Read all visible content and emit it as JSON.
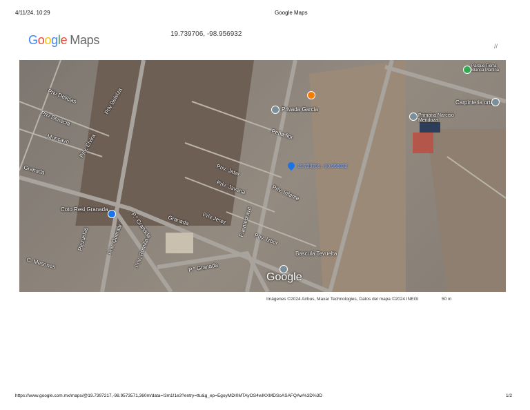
{
  "print_header": {
    "datetime": "4/11/24, 10:29",
    "title": "Google Maps"
  },
  "logo": {
    "google": "Google",
    "maps": "Maps"
  },
  "coordinates": "19.739706, -98.956932",
  "map": {
    "pin_label": "19.739706, -98.956932",
    "labels": [
      "Priv Delicias",
      "Priv Benecia",
      "Priv Beleiza",
      "Moncayo",
      "Granada",
      "Priv. Elvira",
      "Granada",
      "Privada Garcia",
      "Peña flor",
      "Priv. Jatar",
      "Priv. Javena",
      "Priv. Infante",
      "Priv Jerez",
      "Fuentebrava",
      "Priv. Izbor",
      "Bascula Tevuelta",
      "Coto Resi Granada",
      "Plazuelas",
      "Priv. Quentar",
      "Priv. Romilla",
      "P.° Granada",
      "P.° Granada",
      "C. Mesones",
      "Primaria Narciso Mendoza",
      "Carpinteria orta",
      "Parque Tierra Blanca Martina"
    ],
    "watermark": "Google",
    "attribution": "Imágenes ©2024 Airbus, Maxar Technologies, Datos del mapa ©2024 INEGI",
    "scale": "50 m",
    "colors": {
      "pin": "#1a73e8",
      "restaurant": "#f57c00",
      "poi": "#7b8f99"
    }
  },
  "print_footer": {
    "url": "https://www.google.com.mx/maps/@19.7397217,-98.9573571,360m/data=!3m1!1e3?entry=ttu&g_ep=EgoyMDI0MTAyOS4wIKXMDSoASAFQAw%3D%3D",
    "page": "1/2"
  }
}
